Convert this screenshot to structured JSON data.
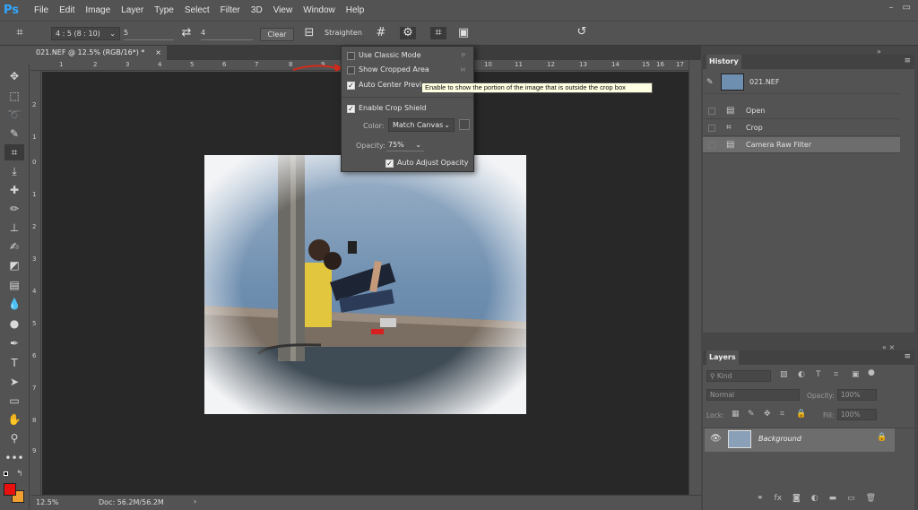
{
  "app": {
    "logo": "Ps",
    "menu": [
      "File",
      "Edit",
      "Image",
      "Layer",
      "Type",
      "Select",
      "Filter",
      "3D",
      "View",
      "Window",
      "Help"
    ],
    "win_controls": [
      "–",
      "▭"
    ]
  },
  "options": {
    "ratio": "4 : 5 (8 : 10)",
    "width": "5",
    "height": "4",
    "clear": "Clear",
    "straighten": "Straighten"
  },
  "doc": {
    "tab": "021.NEF @ 12.5% (RGB/16*) *",
    "tab_close": "×",
    "zoom": "12.5%",
    "docsize": "Doc: 56.2M/56.2M",
    "status_arrow": "›"
  },
  "ruler": {
    "h": [
      "1",
      "2",
      "3",
      "4",
      "5",
      "6",
      "7",
      "8",
      "9",
      "10",
      "11",
      "12",
      "13",
      "14",
      "15",
      "16",
      "17"
    ],
    "v": [
      "2",
      "1",
      "0",
      "1",
      "2",
      "3",
      "4",
      "5",
      "6",
      "7",
      "8",
      "9"
    ]
  },
  "dropdown": {
    "use_classic": "Use Classic Mode",
    "use_classic_key": "P",
    "show_cropped": "Show Cropped Area",
    "show_cropped_key": "H",
    "auto_center": "Auto Center Preview",
    "crop_shield": "Enable Crop Shield",
    "color_label": "Color:",
    "color_value": "Match Canvas",
    "opacity_label": "Opacity:",
    "opacity_value": "75%",
    "auto_adjust": "Auto Adjust Opacity"
  },
  "tooltip": "Enable to show the portion of the image that is outside the crop box",
  "history": {
    "title": "History",
    "snapshot": "021.NEF",
    "items": [
      "Open",
      "Crop",
      "Camera Raw Filter"
    ]
  },
  "layers": {
    "title": "Layers",
    "filter": "Kind",
    "blend": "Normal",
    "opacity_label": "Opacity:",
    "opacity_value": "100%",
    "lock_label": "Lock:",
    "fill_label": "Fill:",
    "fill_value": "100%",
    "layer_name": "Background"
  },
  "colors": {
    "foreground": "#e8110f",
    "background": "#f0a030",
    "accent": "#31a8ff"
  }
}
